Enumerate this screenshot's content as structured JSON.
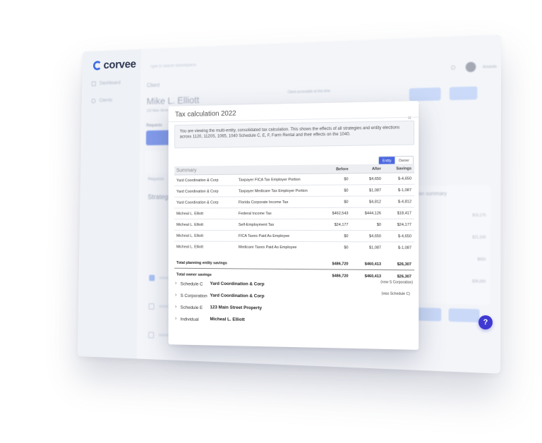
{
  "app": {
    "logo": "corvee",
    "search_placeholder": "Type to search Marketplace",
    "nav": [
      {
        "label": "Dashboard"
      },
      {
        "label": "Clients"
      }
    ],
    "user": "Amanda"
  },
  "client_page": {
    "heading": "Client",
    "client_name": "Mike L. Elliott",
    "address": "123 Main Street",
    "access_text": "Client accessible at this time",
    "requests_label": "Requests",
    "tabs": [
      "Requests",
      "Strategies"
    ],
    "summary_panel_title": "Plan summary",
    "panel_values": [
      "$15,170",
      "$21,100",
      "$550",
      "$36,000"
    ]
  },
  "modal": {
    "title": "Tax calculation 2022",
    "close": "×",
    "notice": "You are viewing the multi-entity, consolidated tax calculation. This shows the effects of all strategies and entity elections across 1120, 1120S, 1065, 1040 Schedule C, E, F, Farm Rental and their effects on the 1040.",
    "toggle": {
      "entity": "Entity",
      "owner": "Owner"
    },
    "table": {
      "summary_label": "Summary",
      "headers": {
        "before": "Before",
        "after": "After",
        "savings": "Savings"
      },
      "rows": [
        {
          "entity": "Yard Coordination & Corp",
          "item": "Taxpayer FICA Tax Employer Portion",
          "before": "$0",
          "after": "$4,650",
          "savings": "$-4,650"
        },
        {
          "entity": "Yard Coordination & Corp",
          "item": "Taxpayer Medicare Tax Employer Portion",
          "before": "$0",
          "after": "$1,087",
          "savings": "$-1,087"
        },
        {
          "entity": "Yard Coordination & Corp",
          "item": "Florida Corporate Income Tax",
          "before": "$0",
          "after": "$4,812",
          "savings": "$-4,812"
        },
        {
          "entity": "Micheal L. Elliott",
          "item": "Federal Income Tax",
          "before": "$462,543",
          "after": "$444,126",
          "savings": "$18,417"
        },
        {
          "entity": "Micheal L. Elliott",
          "item": "Self-Employment Tax",
          "before": "$24,177",
          "after": "$0",
          "savings": "$24,177"
        },
        {
          "entity": "Micheal L. Elliott",
          "item": "FICA Taxes Paid As Employee",
          "before": "$0",
          "after": "$4,650",
          "savings": "$-4,650"
        },
        {
          "entity": "Micheal L. Elliott",
          "item": "Medicare Taxes Paid As Employee",
          "before": "$0",
          "after": "$1,087",
          "savings": "$-1,087"
        }
      ],
      "totals": [
        {
          "label": "Total planning entity savings",
          "before": "$486,720",
          "after": "$460,413",
          "savings": "$26,307"
        },
        {
          "label": "Total owner savings",
          "before": "$486,720",
          "after": "$460,413",
          "savings": "$26,307"
        }
      ]
    },
    "breakdown": [
      {
        "type": "Schedule C",
        "name": "Yard Coordination & Corp",
        "note": "(now S Corporation)"
      },
      {
        "type": "S Corporation",
        "name": "Yard Coordination & Corp",
        "note": "(was Schedule C)"
      },
      {
        "type": "Schedule E",
        "name": "123 Main Street Property",
        "note": ""
      },
      {
        "type": "Individual",
        "name": "Micheal L. Elliott",
        "note": ""
      }
    ]
  },
  "help_button": "?"
}
